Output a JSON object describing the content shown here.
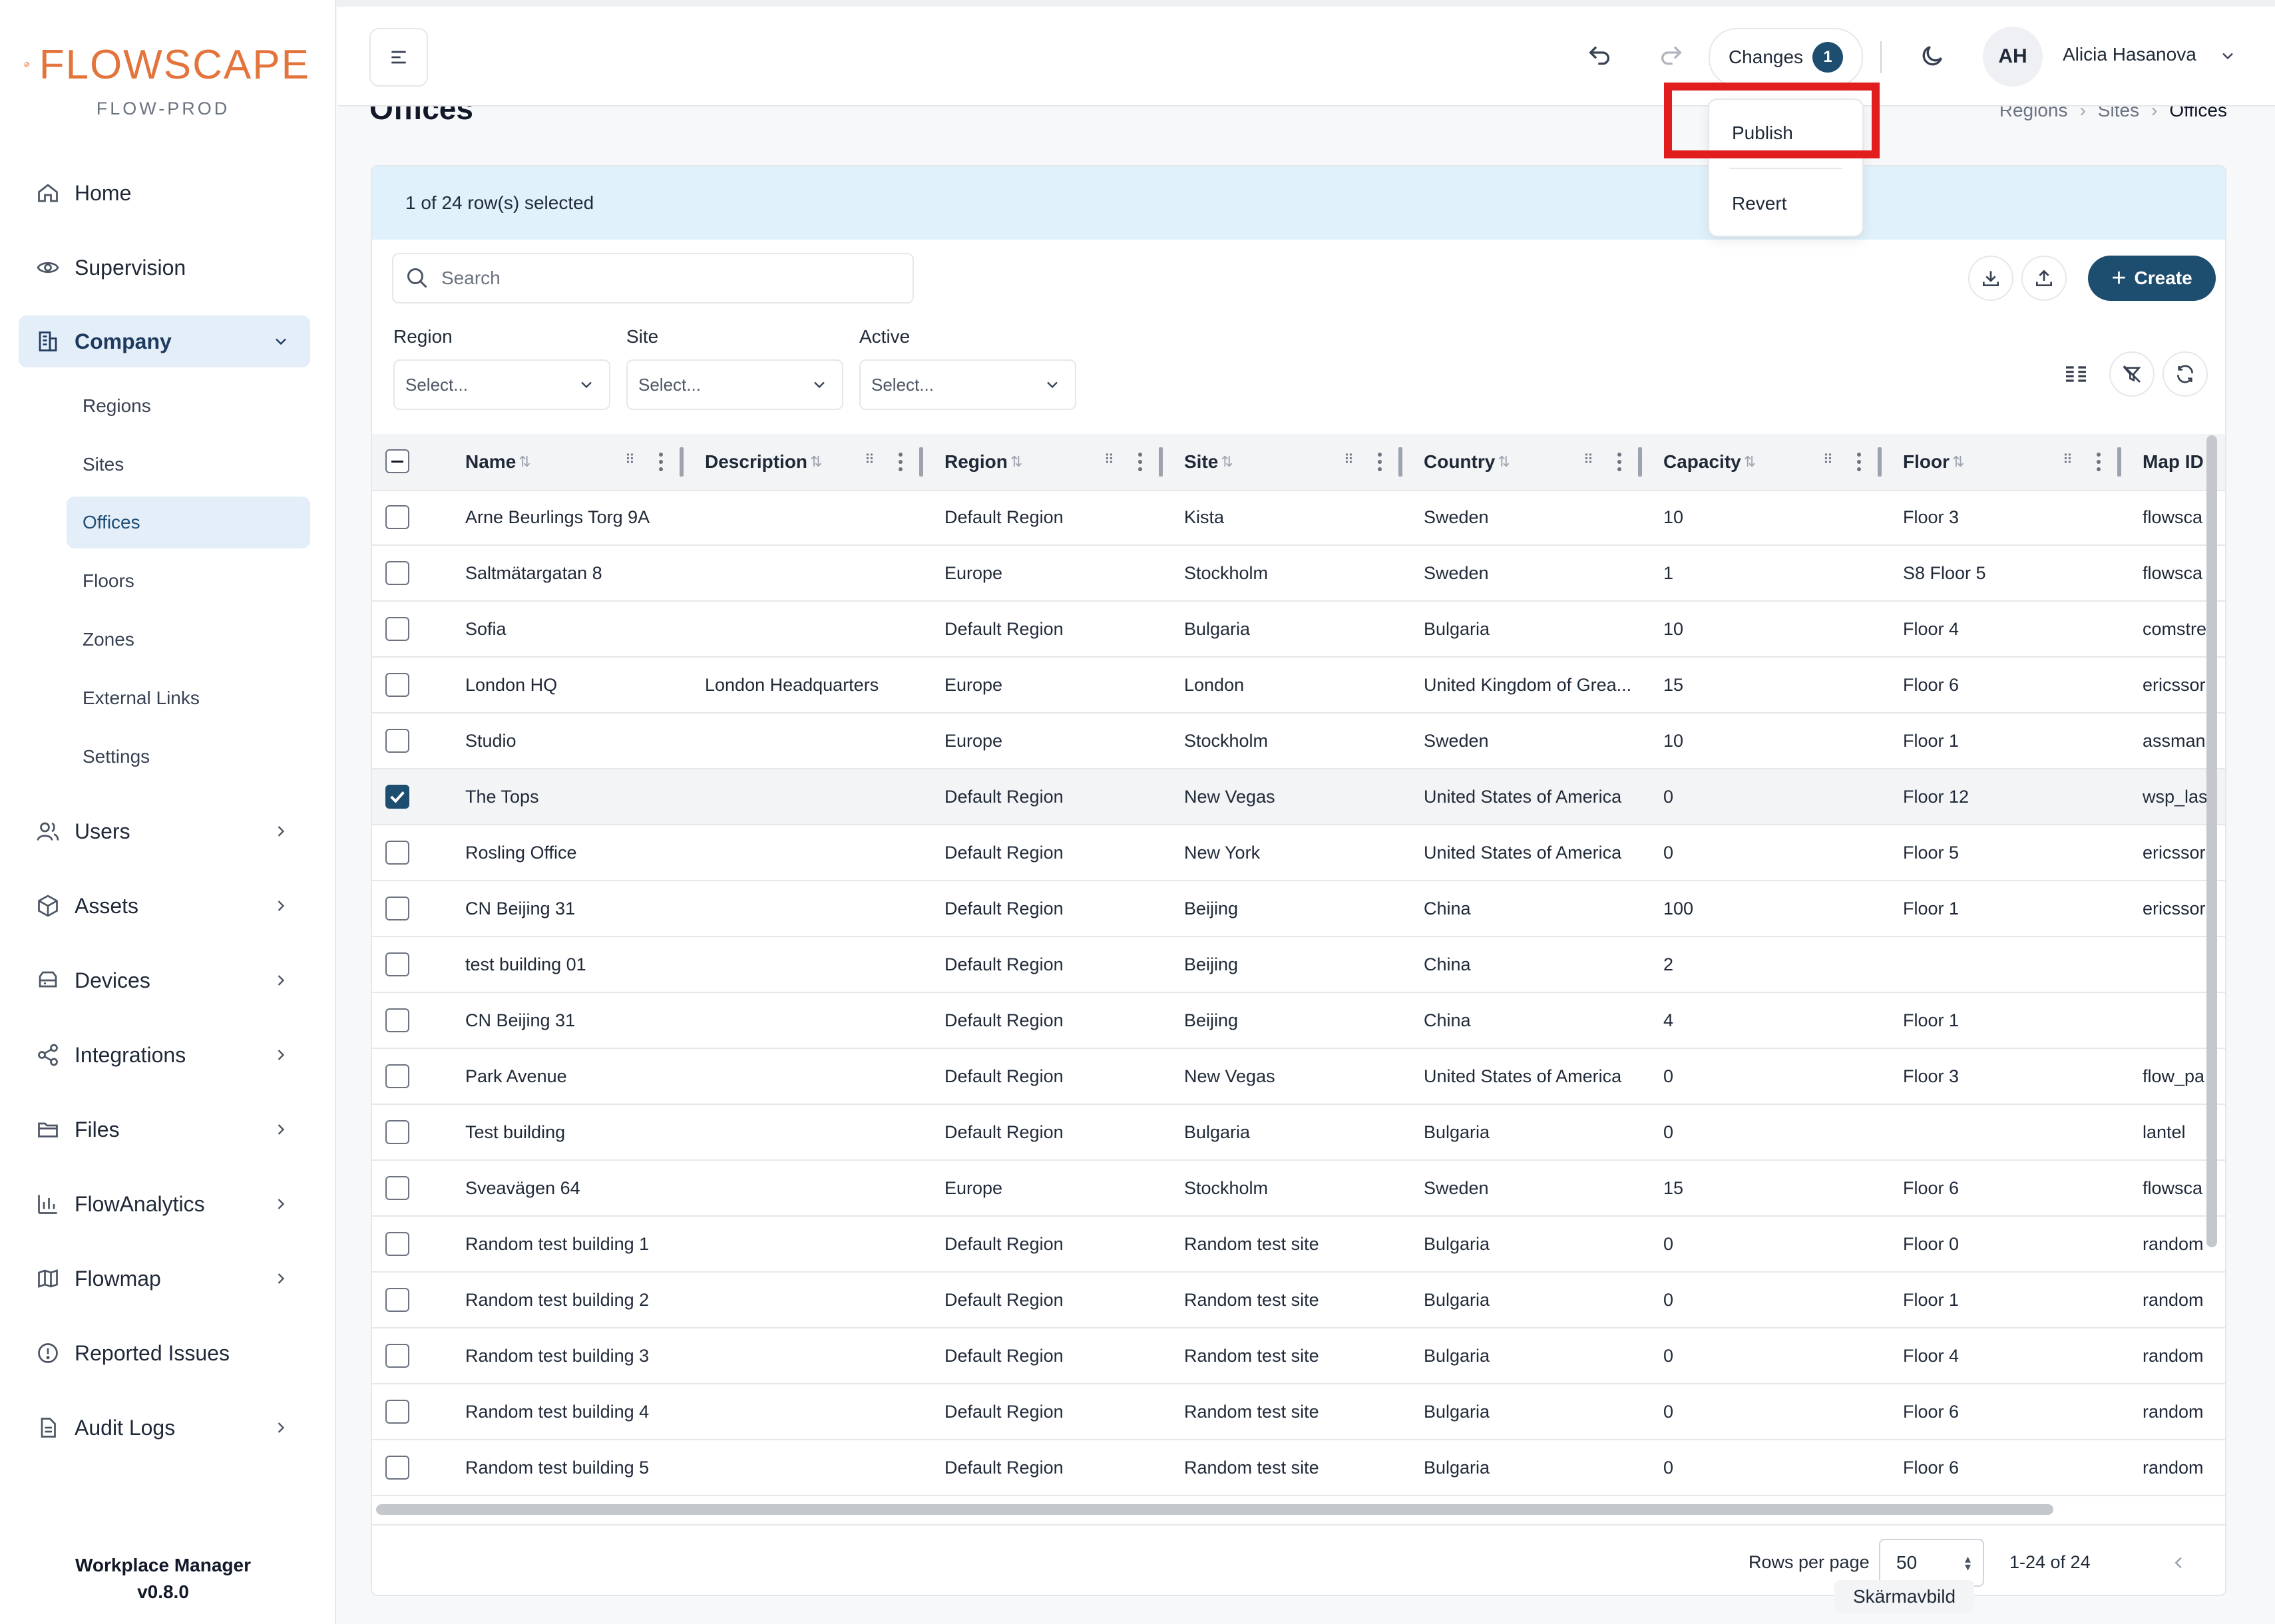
{
  "app": {
    "brand": "FLOWSCAPE",
    "environment": "FLOW-PROD",
    "version_line1": "Workplace Manager",
    "version_line2": "v0.8.0",
    "accent_color": "#1e4e6f",
    "brand_color": "#e3743c"
  },
  "sidebar": {
    "items": [
      {
        "label": "Home",
        "icon": "home-icon"
      },
      {
        "label": "Supervision",
        "icon": "eye-icon"
      },
      {
        "label": "Company",
        "icon": "building-icon"
      },
      {
        "label": "Users",
        "icon": "users-icon"
      },
      {
        "label": "Assets",
        "icon": "box-icon"
      },
      {
        "label": "Devices",
        "icon": "device-icon"
      },
      {
        "label": "Integrations",
        "icon": "share-icon"
      },
      {
        "label": "Files",
        "icon": "folder-icon"
      },
      {
        "label": "FlowAnalytics",
        "icon": "bar-chart-icon"
      },
      {
        "label": "Flowmap",
        "icon": "map-icon"
      },
      {
        "label": "Reported Issues",
        "icon": "alert-circle-icon"
      },
      {
        "label": "Audit Logs",
        "icon": "document-icon"
      }
    ],
    "company_sub": [
      "Regions",
      "Sites",
      "Offices",
      "Floors",
      "Zones",
      "External Links",
      "Settings"
    ]
  },
  "header": {
    "changes_label": "Changes",
    "changes_count": "1",
    "avatar_initials": "AH",
    "user_name": "Alicia Hasanova"
  },
  "changes_menu": {
    "publish": "Publish",
    "revert": "Revert"
  },
  "page": {
    "title": "Offices",
    "breadcrumb": [
      "Regions",
      "Sites",
      "Offices"
    ]
  },
  "toolbar": {
    "selection_text": "1 of 24 row(s) selected",
    "search_placeholder": "Search",
    "create_label": "Create"
  },
  "filters": [
    {
      "label": "Region",
      "value": "Select..."
    },
    {
      "label": "Site",
      "value": "Select..."
    },
    {
      "label": "Active",
      "value": "Select..."
    }
  ],
  "table": {
    "columns": [
      "Name",
      "Description",
      "Region",
      "Site",
      "Country",
      "Capacity",
      "Floor",
      "Map ID"
    ],
    "rows": [
      {
        "name": "Arne Beurlings Torg 9A",
        "description": "",
        "region": "Default Region",
        "site": "Kista",
        "country": "Sweden",
        "capacity": "10",
        "floor": "Floor 3",
        "map_id": "flowsca",
        "selected": false
      },
      {
        "name": "Saltmätargatan 8",
        "description": "",
        "region": "Europe",
        "site": "Stockholm",
        "country": "Sweden",
        "capacity": "1",
        "floor": "S8 Floor 5",
        "map_id": "flowsca",
        "selected": false
      },
      {
        "name": "Sofia",
        "description": "",
        "region": "Default Region",
        "site": "Bulgaria",
        "country": "Bulgaria",
        "capacity": "10",
        "floor": "Floor 4",
        "map_id": "comstre",
        "selected": false
      },
      {
        "name": "London HQ",
        "description": "London Headquarters",
        "region": "Europe",
        "site": "London",
        "country": "United Kingdom of Grea...",
        "capacity": "15",
        "floor": "Floor 6",
        "map_id": "ericssor",
        "selected": false
      },
      {
        "name": "Studio",
        "description": "",
        "region": "Europe",
        "site": "Stockholm",
        "country": "Sweden",
        "capacity": "10",
        "floor": "Floor 1",
        "map_id": "assman",
        "selected": false
      },
      {
        "name": "The Tops",
        "description": "",
        "region": "Default Region",
        "site": "New Vegas",
        "country": "United States of America",
        "capacity": "0",
        "floor": "Floor 12",
        "map_id": "wsp_las",
        "selected": true
      },
      {
        "name": "Rosling Office",
        "description": "",
        "region": "Default Region",
        "site": "New York",
        "country": "United States of America",
        "capacity": "0",
        "floor": "Floor 5",
        "map_id": "ericssor",
        "selected": false
      },
      {
        "name": "CN Beijing 31",
        "description": "",
        "region": "Default Region",
        "site": "Beijing",
        "country": "China",
        "capacity": "100",
        "floor": "Floor 1",
        "map_id": "ericssor",
        "selected": false
      },
      {
        "name": "test building 01",
        "description": "",
        "region": "Default Region",
        "site": "Beijing",
        "country": "China",
        "capacity": "2",
        "floor": "",
        "map_id": "",
        "selected": false
      },
      {
        "name": "CN Beijing 31",
        "description": "",
        "region": "Default Region",
        "site": "Beijing",
        "country": "China",
        "capacity": "4",
        "floor": "Floor 1",
        "map_id": "",
        "selected": false
      },
      {
        "name": "Park Avenue",
        "description": "",
        "region": "Default Region",
        "site": "New Vegas",
        "country": "United States of America",
        "capacity": "0",
        "floor": "Floor 3",
        "map_id": "flow_pa",
        "selected": false
      },
      {
        "name": "Test building",
        "description": "",
        "region": "Default Region",
        "site": "Bulgaria",
        "country": "Bulgaria",
        "capacity": "0",
        "floor": "",
        "map_id": "lantel",
        "selected": false
      },
      {
        "name": "Sveavägen 64",
        "description": "",
        "region": "Europe",
        "site": "Stockholm",
        "country": "Sweden",
        "capacity": "15",
        "floor": "Floor 6",
        "map_id": "flowsca",
        "selected": false
      },
      {
        "name": "Random test building 1",
        "description": "",
        "region": "Default Region",
        "site": "Random test site",
        "country": "Bulgaria",
        "capacity": "0",
        "floor": "Floor 0",
        "map_id": "random",
        "selected": false
      },
      {
        "name": "Random test building 2",
        "description": "",
        "region": "Default Region",
        "site": "Random test site",
        "country": "Bulgaria",
        "capacity": "0",
        "floor": "Floor 1",
        "map_id": "random",
        "selected": false
      },
      {
        "name": "Random test building 3",
        "description": "",
        "region": "Default Region",
        "site": "Random test site",
        "country": "Bulgaria",
        "capacity": "0",
        "floor": "Floor 4",
        "map_id": "random",
        "selected": false
      },
      {
        "name": "Random test building 4",
        "description": "",
        "region": "Default Region",
        "site": "Random test site",
        "country": "Bulgaria",
        "capacity": "0",
        "floor": "Floor 6",
        "map_id": "random",
        "selected": false
      },
      {
        "name": "Random test building 5",
        "description": "",
        "region": "Default Region",
        "site": "Random test site",
        "country": "Bulgaria",
        "capacity": "0",
        "floor": "Floor 6",
        "map_id": "random",
        "selected": false
      }
    ]
  },
  "pagination": {
    "rows_per_page_label": "Rows per page",
    "rows_per_page": "50",
    "range": "1-24 of 24"
  },
  "tooltip": "Skärmavbild"
}
